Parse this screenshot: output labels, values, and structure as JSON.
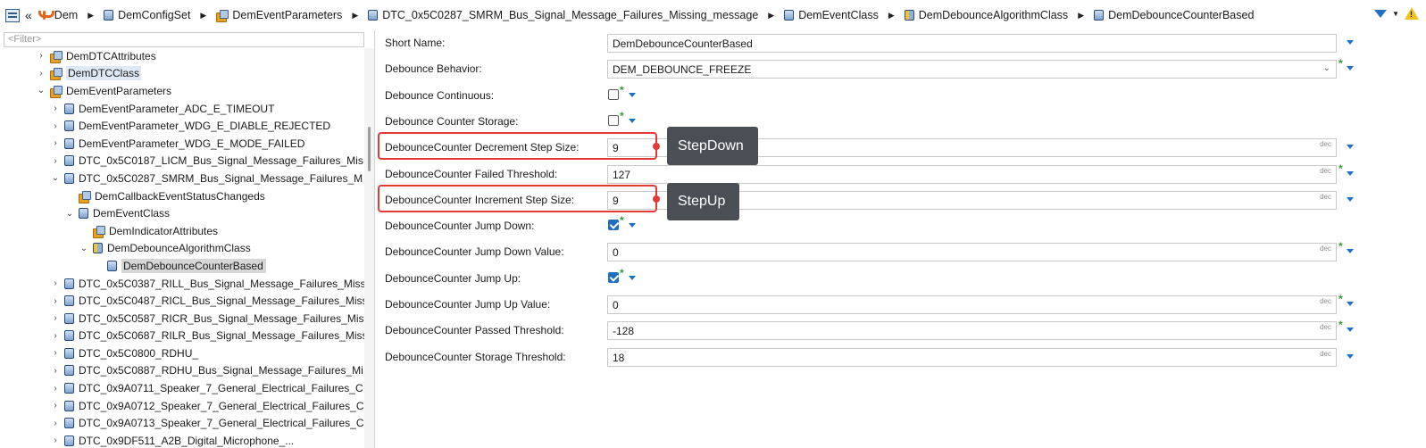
{
  "breadcrumb": {
    "items": [
      {
        "label": "Dem",
        "icon": "dem-module-icon"
      },
      {
        "label": "DemConfigSet",
        "icon": "container-icon"
      },
      {
        "label": "DemEventParameters",
        "icon": "folder-icon"
      },
      {
        "label": "DTC_0x5C0287_SMRM_Bus_Signal_Message_Failures_Missing_message",
        "icon": "container-icon"
      },
      {
        "label": "DemEventClass",
        "icon": "container-icon"
      },
      {
        "label": "DemDebounceAlgorithmClass",
        "icon": "choice-container-icon"
      },
      {
        "label": "DemDebounceCounterBased",
        "icon": "container-icon"
      }
    ],
    "back_glyph": "«"
  },
  "tree": {
    "filter_placeholder": "<Filter>",
    "rows": [
      {
        "label": "DemDTCAttributes",
        "icon": "folder",
        "twisty": "›"
      },
      {
        "label": "DemDTCClass",
        "icon": "folder",
        "twisty": "›"
      },
      {
        "label": "DemEventParameters",
        "icon": "folder",
        "twisty": "⌄"
      },
      {
        "label": "DemEventParameter_ADC_E_TIMEOUT",
        "icon": "cube",
        "twisty": "›"
      },
      {
        "label": "DemEventParameter_WDG_E_DIABLE_REJECTED",
        "icon": "cube",
        "twisty": "›"
      },
      {
        "label": "DemEventParameter_WDG_E_MODE_FAILED",
        "icon": "cube",
        "twisty": "›"
      },
      {
        "label": "DTC_0x5C0187_LICM_Bus_Signal_Message_Failures_Mis",
        "icon": "cube",
        "twisty": "›"
      },
      {
        "label": "DTC_0x5C0287_SMRM_Bus_Signal_Message_Failures_M",
        "icon": "cube",
        "twisty": "⌄"
      },
      {
        "label": "DemCallbackEventStatusChangeds",
        "icon": "folder",
        "twisty": ""
      },
      {
        "label": "DemEventClass",
        "icon": "cube",
        "twisty": "⌄"
      },
      {
        "label": "DemIndicatorAttributes",
        "icon": "folder",
        "twisty": ""
      },
      {
        "label": "DemDebounceAlgorithmClass",
        "icon": "ycube",
        "twisty": "⌄"
      },
      {
        "label": "DemDebounceCounterBased",
        "icon": "cube",
        "twisty": ""
      },
      {
        "label": "DTC_0x5C0387_RILL_Bus_Signal_Message_Failures_Miss",
        "icon": "cube",
        "twisty": "›"
      },
      {
        "label": "DTC_0x5C0487_RICL_Bus_Signal_Message_Failures_Miss",
        "icon": "cube",
        "twisty": "›"
      },
      {
        "label": "DTC_0x5C0587_RICR_Bus_Signal_Message_Failures_Mis",
        "icon": "cube",
        "twisty": "›"
      },
      {
        "label": "DTC_0x5C0687_RILR_Bus_Signal_Message_Failures_Miss",
        "icon": "cube",
        "twisty": "›"
      },
      {
        "label": "DTC_0x5C0800_RDHU_",
        "icon": "cube",
        "twisty": "›"
      },
      {
        "label": "DTC_0x5C0887_RDHU_Bus_Signal_Message_Failures_Mi",
        "icon": "cube",
        "twisty": "›"
      },
      {
        "label": "DTC_0x9A0711_Speaker_7_General_Electrical_Failures_C",
        "icon": "cube",
        "twisty": "›"
      },
      {
        "label": "DTC_0x9A0712_Speaker_7_General_Electrical_Failures_C",
        "icon": "cube",
        "twisty": "›"
      },
      {
        "label": "DTC_0x9A0713_Speaker_7_General_Electrical_Failures_C",
        "icon": "cube",
        "twisty": "›"
      },
      {
        "label": "DTC_0x9DF511_A2B_Digital_Microphone_...",
        "icon": "cube",
        "twisty": "›"
      }
    ]
  },
  "properties": [
    {
      "label": "Short Name:",
      "kind": "text",
      "value": "DemDebounceCounterBased",
      "unit": "",
      "required": false
    },
    {
      "label": "Debounce Behavior:",
      "kind": "select",
      "value": "DEM_DEBOUNCE_FREEZE",
      "unit": "",
      "chevron": "⌄",
      "required": true
    },
    {
      "label": "Debounce Continuous:",
      "kind": "check",
      "checked": false,
      "required": true
    },
    {
      "label": "Debounce Counter Storage:",
      "kind": "check",
      "checked": false,
      "required": true
    },
    {
      "label": "DebounceCounter Decrement Step Size:",
      "kind": "text",
      "value": "9",
      "unit": "dec",
      "required": false
    },
    {
      "label": "DebounceCounter Failed Threshold:",
      "kind": "text",
      "value": "127",
      "unit": "dec",
      "required": true
    },
    {
      "label": "DebounceCounter Increment Step Size:",
      "kind": "text",
      "value": "9",
      "unit": "dec",
      "required": false
    },
    {
      "label": "DebounceCounter Jump Down:",
      "kind": "check",
      "checked": true,
      "required": true
    },
    {
      "label": "DebounceCounter Jump Down Value:",
      "kind": "text",
      "value": "0",
      "unit": "dec",
      "required": true
    },
    {
      "label": "DebounceCounter Jump Up:",
      "kind": "check",
      "checked": true,
      "required": true
    },
    {
      "label": "DebounceCounter Jump Up Value:",
      "kind": "text",
      "value": "0",
      "unit": "dec",
      "required": true
    },
    {
      "label": "DebounceCounter Passed Threshold:",
      "kind": "text",
      "value": "-128",
      "unit": "dec",
      "required": true
    },
    {
      "label": "DebounceCounter Storage Threshold:",
      "kind": "text",
      "value": "18",
      "unit": "dec",
      "required": false
    }
  ],
  "required_marker": "*",
  "callouts": {
    "step_down": "StepDown",
    "step_up": "StepUp"
  },
  "colors": {
    "highlight": "#e53935",
    "callout_bg": "#4a4f55",
    "accent": "#1f72c2",
    "required": "#2e9d2e"
  }
}
